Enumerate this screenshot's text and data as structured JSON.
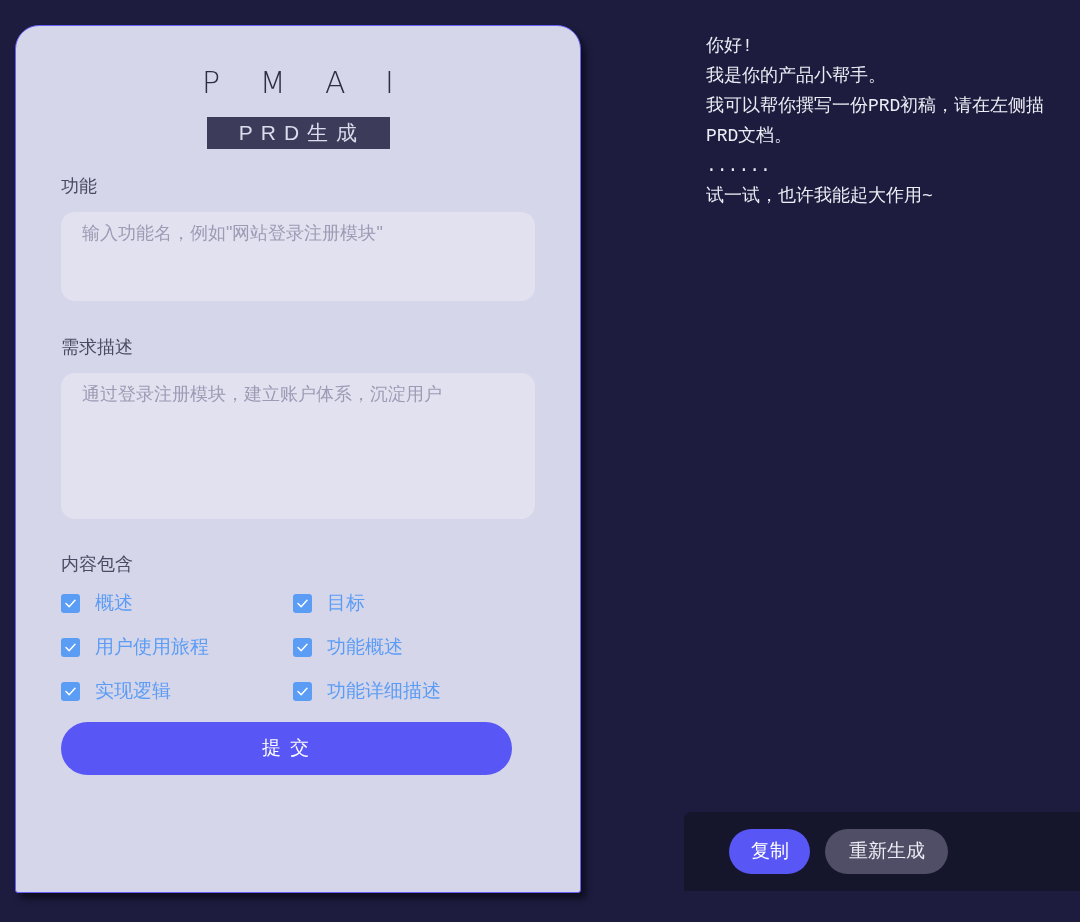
{
  "logo": {
    "text": "P M A I"
  },
  "title_banner": {
    "text": "PRD生成"
  },
  "form": {
    "fields": [
      {
        "kind": "input",
        "label": "功能",
        "placeholder": "输入功能名，例如\"网站登录注册模块\""
      },
      {
        "kind": "textarea",
        "label": "需求描述",
        "placeholder": "通过登录注册模块，建立账户体系，沉淀用户"
      }
    ],
    "content_options": {
      "label": "内容包含",
      "options": [
        {
          "label": "概述",
          "checked": true
        },
        {
          "label": "目标",
          "checked": true
        },
        {
          "label": "用户使用旅程",
          "checked": true
        },
        {
          "label": "功能概述",
          "checked": true
        },
        {
          "label": "实现逻辑",
          "checked": true
        },
        {
          "label": "功能详细描述",
          "checked": true
        }
      ]
    },
    "submit_button": {
      "label": "提 交"
    }
  },
  "response": {
    "lines": [
      "你好!",
      "我是你的产品小帮手。",
      "我可以帮你撰写一份PRD初稿，请在左侧描",
      "PRD文档。",
      "......",
      "试一试，也许我能起大作用~"
    ]
  },
  "actions": [
    {
      "kind": "primary",
      "label": "复制"
    },
    {
      "kind": "secondary",
      "label": "重新生成"
    }
  ]
}
